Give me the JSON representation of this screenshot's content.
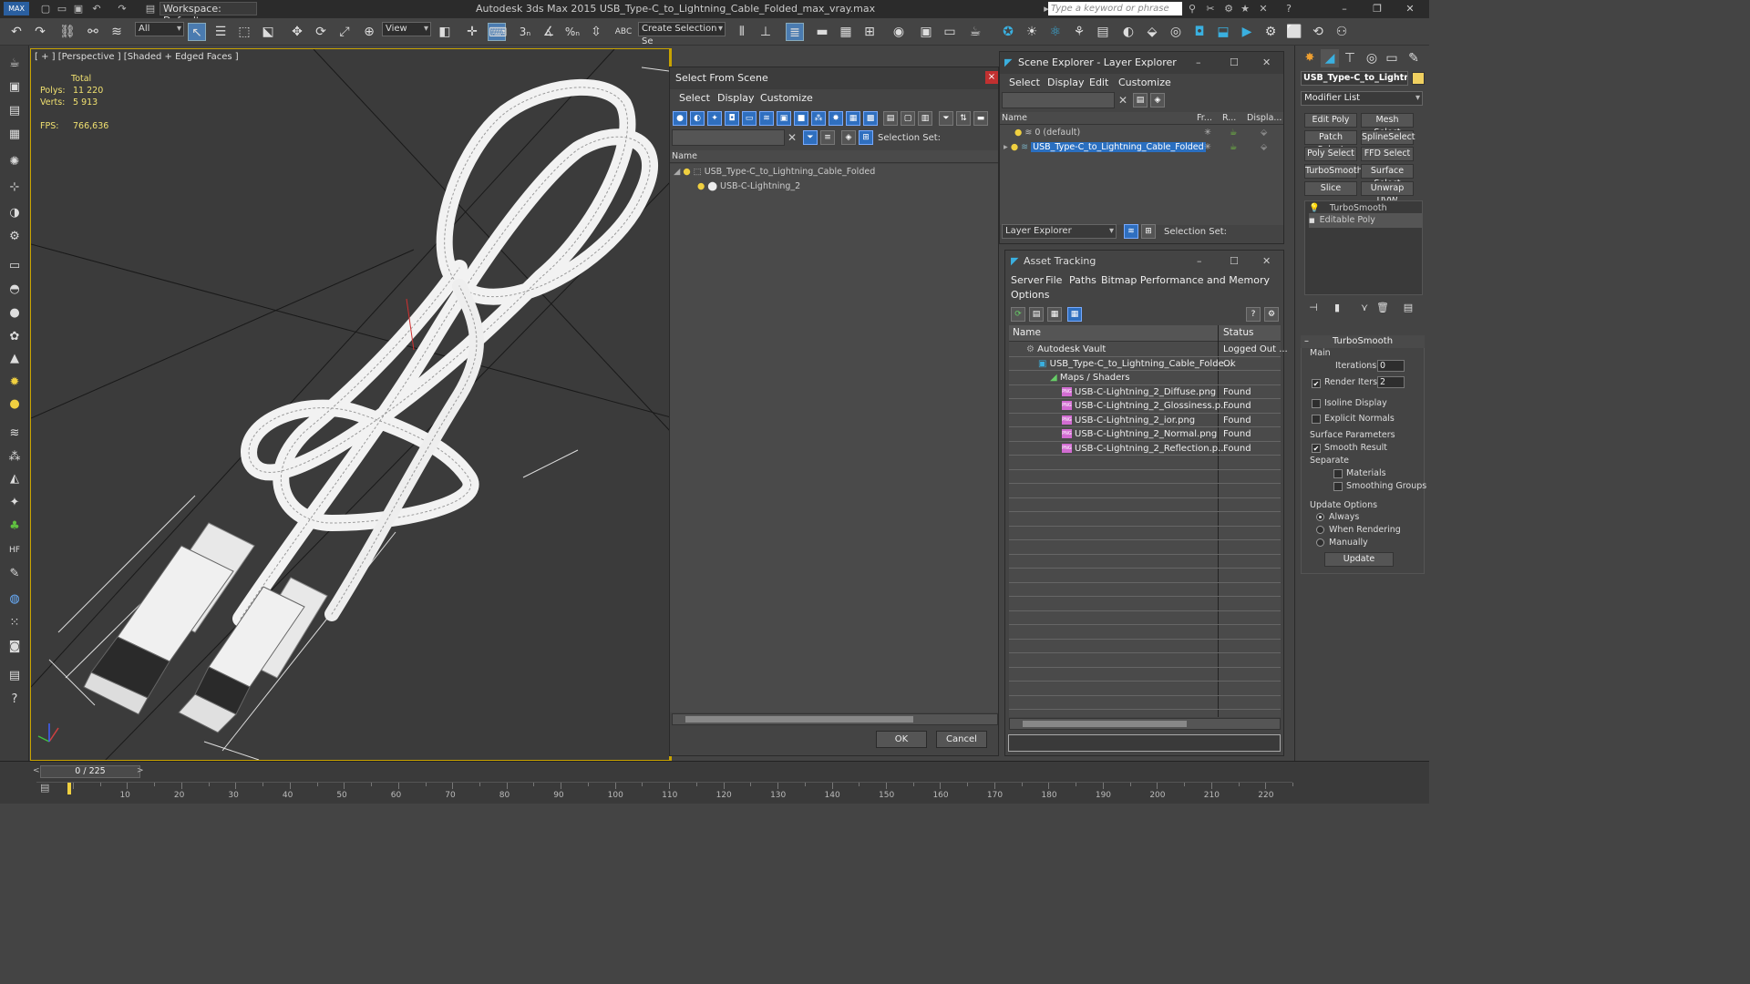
{
  "titlebar": {
    "workspace": "Workspace: Default",
    "app_title": "Autodesk 3ds Max  2015      USB_Type-C_to_Lightning_Cable_Folded_max_vray.max",
    "search_placeholder": "Type a keyword or phrase"
  },
  "toolbar": {
    "filter_combo": "All",
    "view_combo": "View",
    "selection_set_combo": "Create Selection Se"
  },
  "viewport": {
    "label": "[ + ] [Perspective ] [Shaded + Edged Faces ]",
    "stats": {
      "total_label": "Total",
      "polys_label": "Polys:",
      "polys_value": "11 220",
      "verts_label": "Verts:",
      "verts_value": "5 913",
      "fps_label": "FPS:",
      "fps_value": "766,636"
    }
  },
  "select_from_scene": {
    "title": "Select From Scene",
    "menu": [
      "Select",
      "Display",
      "Customize"
    ],
    "selection_set_label": "Selection Set:",
    "column_name": "Name",
    "tree": [
      {
        "label": "USB_Type-C_to_Lightning_Cable_Folded",
        "level": 0
      },
      {
        "label": "USB-C-Lightning_2",
        "level": 1
      }
    ],
    "ok_label": "OK",
    "cancel_label": "Cancel"
  },
  "scene_explorer": {
    "title": "Scene Explorer - Layer Explorer",
    "menu": [
      "Select",
      "Display",
      "Edit",
      "Customize"
    ],
    "columns": [
      "Name",
      "Fr...",
      "R...",
      "Displa..."
    ],
    "rows": [
      {
        "label": "0 (default)",
        "selected": false
      },
      {
        "label": "USB_Type-C_to_Lightning_Cable_Folded",
        "selected": true
      }
    ],
    "footer_combo": "Layer Explorer",
    "selection_set_label": "Selection Set:"
  },
  "asset_tracking": {
    "title": "Asset Tracking",
    "menu": [
      "Server",
      "File",
      "Paths",
      "Bitmap Performance and Memory"
    ],
    "menu_row2": "Options",
    "columns": [
      "Name",
      "Status"
    ],
    "rows": [
      {
        "name": "Autodesk Vault",
        "status": "Logged Out ...",
        "indent": 1,
        "icon": "vault-icon"
      },
      {
        "name": "USB_Type-C_to_Lightning_Cable_Folde...",
        "status": "Ok",
        "indent": 2,
        "icon": "max-file-icon"
      },
      {
        "name": "Maps / Shaders",
        "status": "",
        "indent": 3,
        "icon": "maps-icon"
      },
      {
        "name": "USB-C-Lightning_2_Diffuse.png",
        "status": "Found",
        "indent": 4,
        "icon": "png-icon"
      },
      {
        "name": "USB-C-Lightning_2_Glossiness.p...",
        "status": "Found",
        "indent": 4,
        "icon": "png-icon"
      },
      {
        "name": "USB-C-Lightning_2_ior.png",
        "status": "Found",
        "indent": 4,
        "icon": "png-icon"
      },
      {
        "name": "USB-C-Lightning_2_Normal.png",
        "status": "Found",
        "indent": 4,
        "icon": "png-icon"
      },
      {
        "name": "USB-C-Lightning_2_Reflection.p...",
        "status": "Found",
        "indent": 4,
        "icon": "png-icon"
      }
    ]
  },
  "command_panel": {
    "object_name": "USB_Type-C_to_Lightnin",
    "modifier_list": "Modifier List",
    "buttons": [
      "Edit Poly",
      "Mesh Select",
      "Patch Select",
      "SplineSelect",
      "Poly Select",
      "FFD Select",
      "TurboSmooth",
      "Surface Select",
      "Slice",
      "Unwrap UVW"
    ],
    "stack": [
      "TurboSmooth",
      "Editable Poly"
    ],
    "rollout_title": "TurboSmooth",
    "main_label": "Main",
    "iterations_label": "Iterations:",
    "iterations_value": "0",
    "render_iters_label": "Render Iters:",
    "render_iters_value": "2",
    "isoline_label": "Isoline Display",
    "explicit_normals_label": "Explicit Normals",
    "surface_params_label": "Surface Parameters",
    "smooth_result_label": "Smooth Result",
    "separate_label": "Separate",
    "materials_label": "Materials",
    "smoothing_groups_label": "Smoothing Groups",
    "update_options_label": "Update Options",
    "always_label": "Always",
    "when_rendering_label": "When Rendering",
    "manually_label": "Manually",
    "update_button": "Update"
  },
  "timeline": {
    "slider": "0 / 225",
    "ticks": [
      "10",
      "20",
      "30",
      "40",
      "50",
      "60",
      "70",
      "80",
      "90",
      "100",
      "110",
      "120",
      "130",
      "140",
      "150",
      "160",
      "170",
      "180",
      "190",
      "200",
      "210",
      "220"
    ]
  }
}
